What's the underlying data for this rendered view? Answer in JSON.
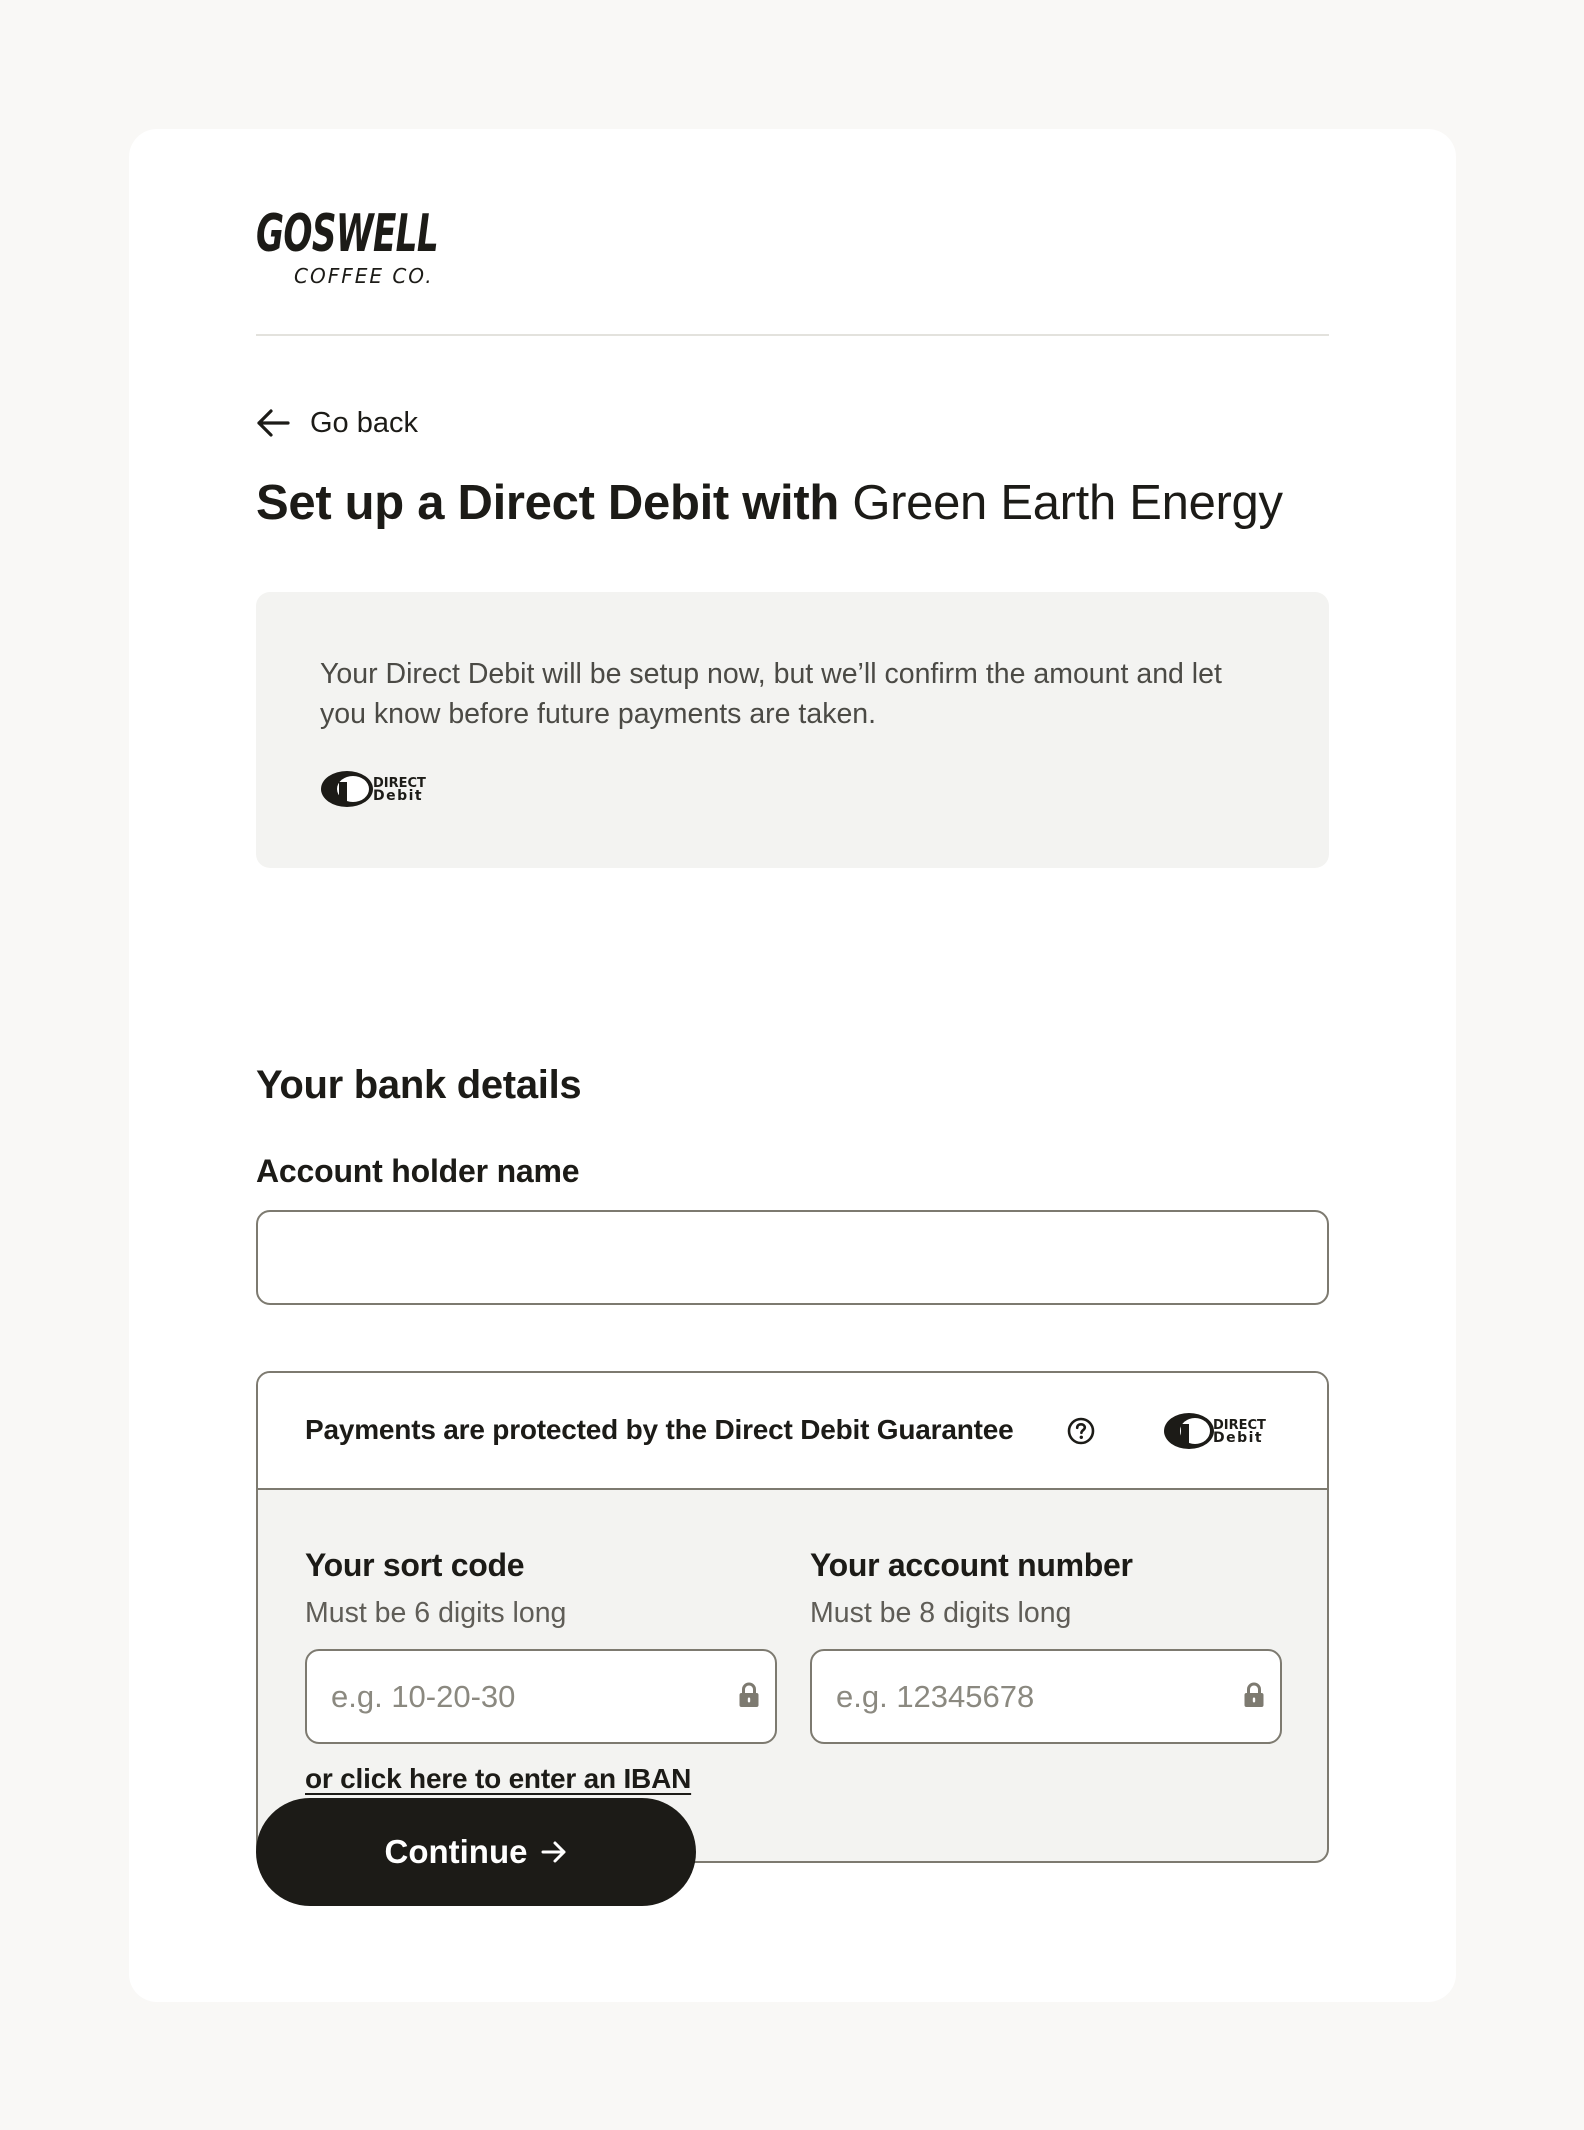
{
  "brand": {
    "logo_line1": "GOSWELL",
    "logo_line2": "COFFEE CO."
  },
  "nav": {
    "back_label": "Go back",
    "back_icon": "arrow-left-icon"
  },
  "header": {
    "title_prefix": "Set up a Direct Debit with",
    "merchant_name": "Green Earth Energy"
  },
  "info": {
    "text": "Your Direct Debit will be setup now, but we’ll confirm the amount and let you know before future payments are taken.",
    "dd_logo_line1": "DIRECT",
    "dd_logo_line2": "Debit"
  },
  "bank_details": {
    "section_title": "Your bank details",
    "account_holder": {
      "label": "Account holder name",
      "value": "",
      "placeholder": ""
    },
    "guarantee": {
      "text": "Payments are protected by the Direct Debit Guarantee",
      "help_icon": "question-circle-icon"
    },
    "sort_code": {
      "label": "Your sort code",
      "hint": "Must be 6 digits long",
      "placeholder": "e.g. 10-20-30",
      "value": ""
    },
    "account_number": {
      "label": "Your account number",
      "hint": "Must be 8 digits long",
      "placeholder": "e.g. 12345678",
      "value": ""
    },
    "iban_link": "or click here to enter an IBAN"
  },
  "actions": {
    "continue_label": "Continue",
    "continue_icon": "arrow-right-icon"
  },
  "colors": {
    "page_bg": "#f9f8f6",
    "card_bg": "#ffffff",
    "panel_bg": "#f3f3f1",
    "border": "#7d7a70",
    "text": "#1c1b17",
    "muted_text": "#5f5d57",
    "button_bg": "#1c1b17",
    "button_text": "#ffffff"
  }
}
